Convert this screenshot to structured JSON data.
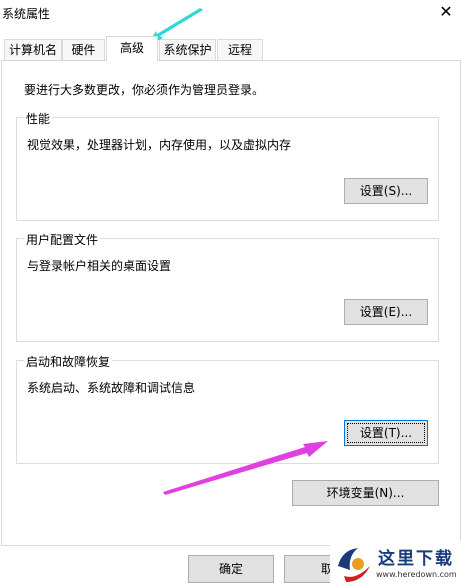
{
  "window": {
    "title": "系统属性",
    "close_glyph": "✕"
  },
  "tabs": [
    {
      "label": "计算机名"
    },
    {
      "label": "硬件"
    },
    {
      "label": "高级",
      "active": true
    },
    {
      "label": "系统保护"
    },
    {
      "label": "远程"
    }
  ],
  "notice": "要进行大多数更改，你必须作为管理员登录。",
  "groups": {
    "performance": {
      "title": "性能",
      "description": "视觉效果，处理器计划，内存使用，以及虚拟内存",
      "button": "设置(S)..."
    },
    "user_profiles": {
      "title": "用户配置文件",
      "description": "与登录帐户相关的桌面设置",
      "button": "设置(E)..."
    },
    "startup_recovery": {
      "title": "启动和故障恢复",
      "description": "系统启动、系统故障和调试信息",
      "button": "设置(T)..."
    }
  },
  "env_button": "环境变量(N)...",
  "footer": {
    "ok": "确定",
    "cancel": "取"
  },
  "watermark": {
    "brand": "这里下载",
    "url": "www.heredown.com"
  },
  "annotation_colors": {
    "cyan_arrow": "#2ed8d8",
    "magenta_arrow": "#e040e0"
  }
}
